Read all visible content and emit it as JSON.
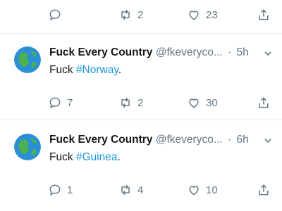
{
  "top_actions": {
    "reply_count": "",
    "retweet_count": "2",
    "like_count": "23"
  },
  "tweets": [
    {
      "name": "Fuck Every Country",
      "handle": "@fkeveryco...",
      "separator": "·",
      "time": "5h",
      "text_prefix": "Fuck ",
      "hashtag": "#Norway",
      "text_suffix": ".",
      "reply_count": "7",
      "retweet_count": "2",
      "like_count": "30"
    },
    {
      "name": "Fuck Every Country",
      "handle": "@fkeveryco...",
      "separator": "·",
      "time": "6h",
      "text_prefix": "Fuck ",
      "hashtag": "#Guinea",
      "text_suffix": ".",
      "reply_count": "1",
      "retweet_count": "4",
      "like_count": "10"
    }
  ],
  "colors": {
    "accent": "#1b95e0",
    "muted": "#657786",
    "divider": "#e6ecf0"
  }
}
